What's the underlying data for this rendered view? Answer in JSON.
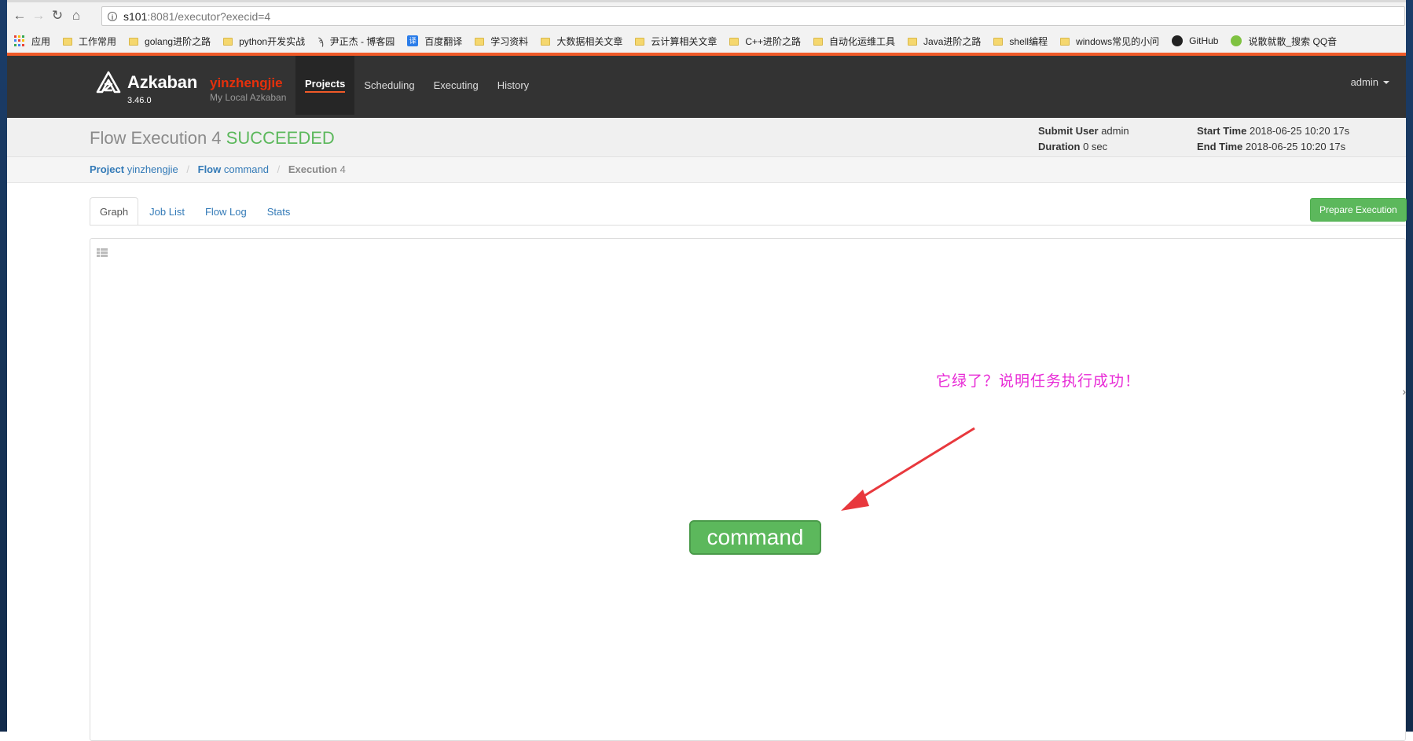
{
  "browser": {
    "url_host": "s101",
    "url_rest": ":8081/executor?execid=4",
    "bookmarks": [
      {
        "label": "应用",
        "icon": "apps-grid-icon"
      },
      {
        "label": "工作常用",
        "icon": "folder-icon"
      },
      {
        "label": "golang进阶之路",
        "icon": "folder-icon"
      },
      {
        "label": "python开发实战",
        "icon": "folder-icon"
      },
      {
        "label": "尹正杰 - 博客园",
        "icon": "feather-icon"
      },
      {
        "label": "百度翻译",
        "icon": "translate-icon"
      },
      {
        "label": "学习资料",
        "icon": "folder-icon"
      },
      {
        "label": "大数据相关文章",
        "icon": "folder-icon"
      },
      {
        "label": "云计算相关文章",
        "icon": "folder-icon"
      },
      {
        "label": "C++进阶之路",
        "icon": "folder-icon"
      },
      {
        "label": "自动化运维工具",
        "icon": "folder-icon"
      },
      {
        "label": "Java进阶之路",
        "icon": "folder-icon"
      },
      {
        "label": "shell编程",
        "icon": "folder-icon"
      },
      {
        "label": "windows常见的小问",
        "icon": "folder-icon"
      },
      {
        "label": "GitHub",
        "icon": "github-icon"
      },
      {
        "label": "说散就散_搜索 QQ音",
        "icon": "qq-music-icon"
      }
    ]
  },
  "header": {
    "brand": "Azkaban",
    "version": "3.46.0",
    "instance": "yinzhengjie",
    "description": "My Local Azkaban",
    "nav": [
      "Projects",
      "Scheduling",
      "Executing",
      "History"
    ],
    "user": "admin"
  },
  "flow": {
    "title": "Flow Execution 4",
    "status": "SUCCEEDED",
    "submit_user_label": "Submit User",
    "submit_user": "admin",
    "duration_label": "Duration",
    "duration": "0 sec",
    "start_time_label": "Start Time",
    "start_time": "2018-06-25 10:20 17s",
    "end_time_label": "End Time",
    "end_time": "2018-06-25 10:20 17s"
  },
  "breadcrumb": {
    "project_label": "Project",
    "project": "yinzhengjie",
    "flow_label": "Flow",
    "flow": "command",
    "execution_label": "Execution",
    "execution": "4"
  },
  "tabs": [
    "Graph",
    "Job List",
    "Flow Log",
    "Stats"
  ],
  "prepare_button": "Prepare Execution",
  "graph": {
    "node_label": "command",
    "node_color": "#5cb85c",
    "annotation": "它绿了？说明任务执行成功！",
    "annotation_color": "#e82ad6"
  },
  "colors": {
    "accent": "#f05a28",
    "success": "#5cb85c",
    "link": "#337ab7"
  }
}
